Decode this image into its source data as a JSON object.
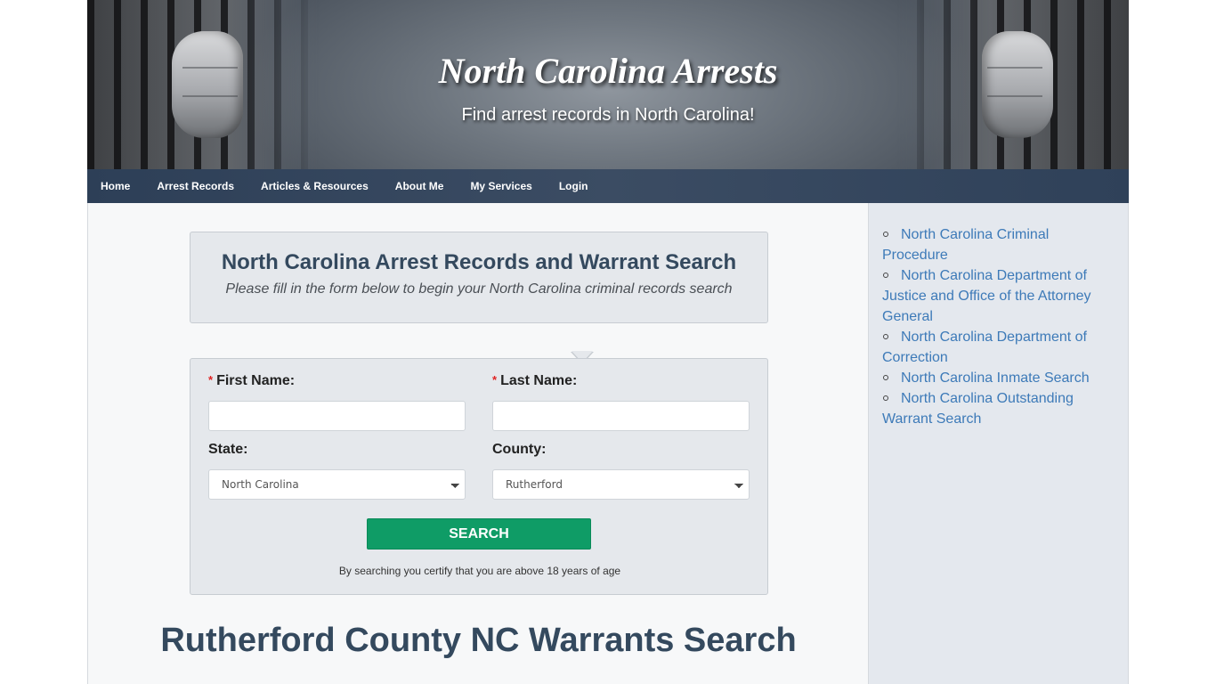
{
  "header": {
    "title": "North Carolina Arrests",
    "tagline": "Find arrest records in North Carolina!"
  },
  "nav": {
    "items": [
      {
        "label": "Home"
      },
      {
        "label": "Arrest Records"
      },
      {
        "label": "Articles & Resources"
      },
      {
        "label": "About Me"
      },
      {
        "label": "My Services"
      },
      {
        "label": "Login"
      }
    ]
  },
  "intro": {
    "heading": "North Carolina Arrest Records and Warrant Search",
    "subheading": "Please fill in the form below to begin your North Carolina criminal records search"
  },
  "form": {
    "required_marker": "*",
    "first_name": {
      "label": "First Name:",
      "value": ""
    },
    "last_name": {
      "label": "Last Name:",
      "value": ""
    },
    "state": {
      "label": "State:",
      "selected": "North Carolina"
    },
    "county": {
      "label": "County:",
      "selected": "Rutherford"
    },
    "search_label": "SEARCH",
    "disclaimer": "By searching you certify that you are above 18 years of age"
  },
  "main": {
    "page_heading": "Rutherford County NC Warrants Search"
  },
  "sidebar": {
    "links": [
      {
        "label": "North Carolina Criminal Procedure"
      },
      {
        "label": "North Carolina Department of Justice and Office of the Attorney General"
      },
      {
        "label": "North Carolina Department of Correction"
      },
      {
        "label": "North Carolina Inmate Search"
      },
      {
        "label": "North Carolina Outstanding Warrant Search"
      }
    ]
  },
  "colors": {
    "nav_bg": "#34465d",
    "heading": "#34495e",
    "link": "#3d7ab8",
    "search_button": "#0f9c66",
    "required": "#e02424"
  }
}
